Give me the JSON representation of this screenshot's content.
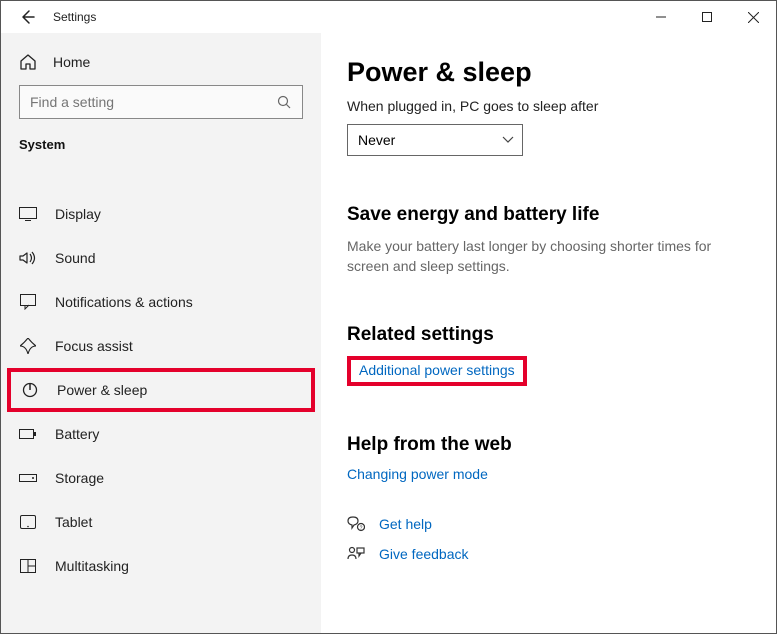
{
  "window": {
    "title": "Settings"
  },
  "sidebar": {
    "home": "Home",
    "search_placeholder": "Find a setting",
    "heading": "System",
    "items": [
      {
        "label": "Display"
      },
      {
        "label": "Sound"
      },
      {
        "label": "Notifications & actions"
      },
      {
        "label": "Focus assist"
      },
      {
        "label": "Power & sleep"
      },
      {
        "label": "Battery"
      },
      {
        "label": "Storage"
      },
      {
        "label": "Tablet"
      },
      {
        "label": "Multitasking"
      }
    ]
  },
  "content": {
    "title": "Power & sleep",
    "sleep_label": "When plugged in, PC goes to sleep after",
    "sleep_value": "Never",
    "energy_heading": "Save energy and battery life",
    "energy_desc": "Make your battery last longer by choosing shorter times for screen and sleep settings.",
    "related_heading": "Related settings",
    "related_link": "Additional power settings",
    "help_heading": "Help from the web",
    "help_link": "Changing power mode",
    "get_help": "Get help",
    "give_feedback": "Give feedback"
  }
}
